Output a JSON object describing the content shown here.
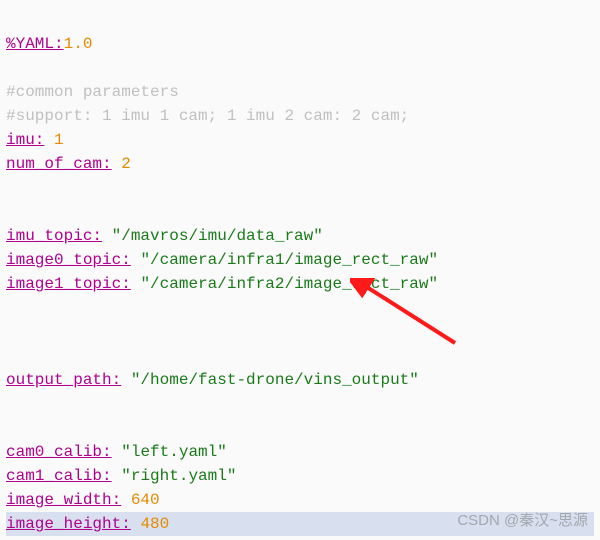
{
  "yaml_label": "%YAML:",
  "yaml_version": "1.0",
  "comments": {
    "common": "#common parameters",
    "support": "#support: 1 imu 1 cam; 1 imu 2 cam: 2 cam;"
  },
  "keys": {
    "imu": "imu:",
    "num_of_cam": "num_of_cam:",
    "imu_topic": "imu_topic:",
    "image0_topic": "image0_topic:",
    "image1_topic": "image1_topic:",
    "output_path": "output_path:",
    "cam0_calib": "cam0_calib:",
    "cam1_calib": "cam1_calib:",
    "image_width": "image_width:",
    "image_height": "image_height:"
  },
  "vals": {
    "imu": "1",
    "num_of_cam": "2",
    "imu_topic": "\"/mavros/imu/data_raw\"",
    "image0_topic": "\"/camera/infra1/image_rect_raw\"",
    "image1_topic": "\"/camera/infra2/image_rect_raw\"",
    "output_path": "\"/home/fast-drone/vins_output\"",
    "cam0_calib": "\"left.yaml\"",
    "cam1_calib": "\"right.yaml\"",
    "image_width": "640",
    "image_height": "480"
  },
  "watermark": "CSDN @秦汉~思源"
}
